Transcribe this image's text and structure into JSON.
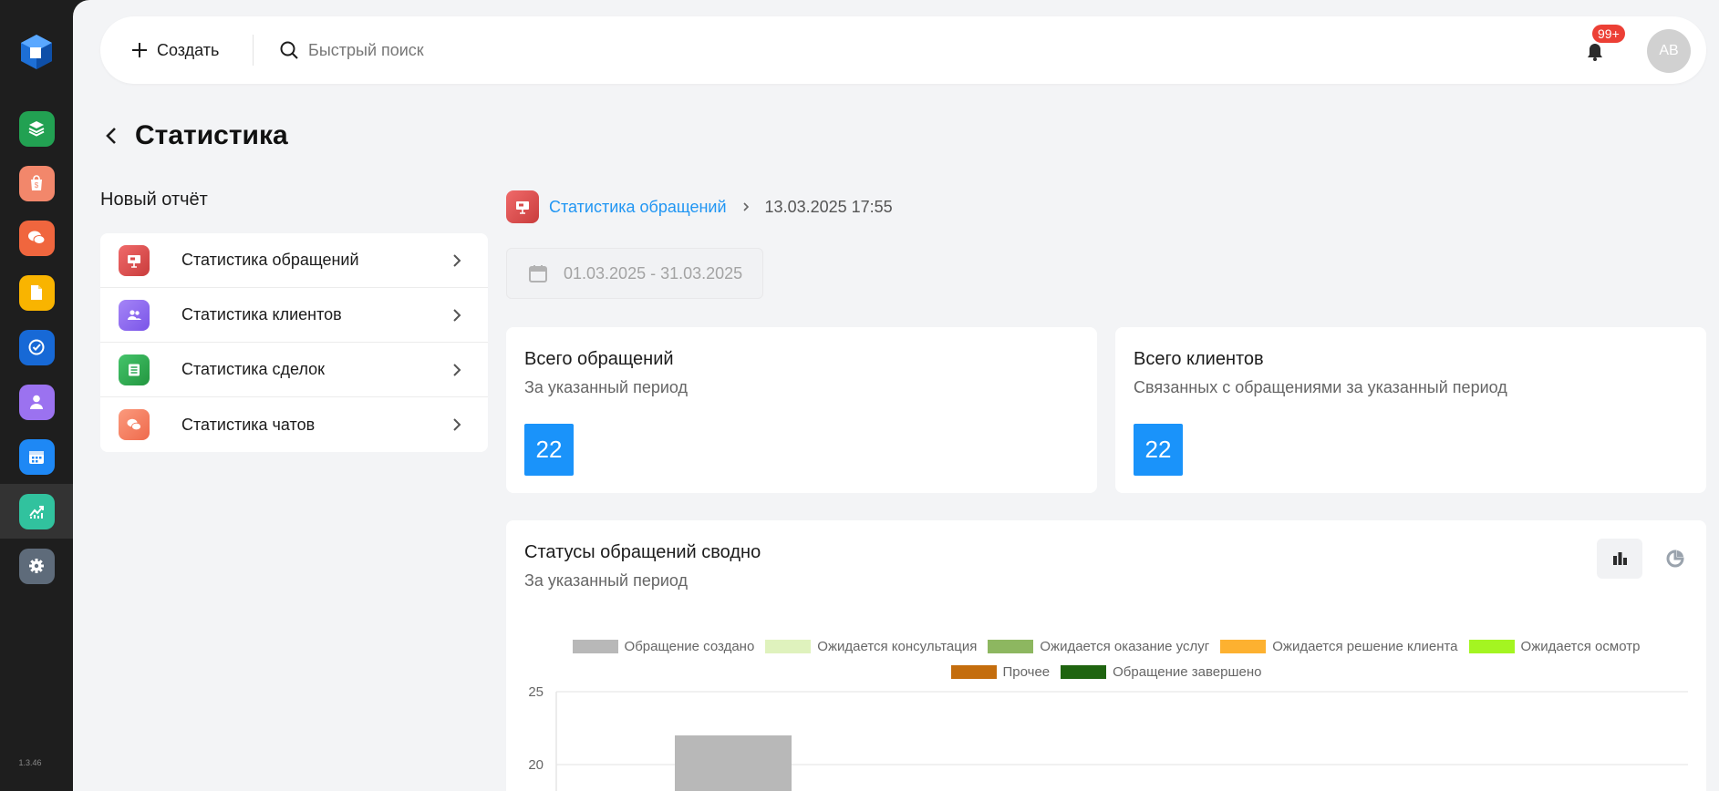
{
  "app": {
    "version": "1.3.46",
    "brand_color": "#1a93fa"
  },
  "sidebar": {
    "items": [
      {
        "name": "layers",
        "icon": "layers-icon",
        "color": "#22a152"
      },
      {
        "name": "shop",
        "icon": "shopping-bag-icon",
        "color": "#f2876b"
      },
      {
        "name": "chats",
        "icon": "chat-bubbles-icon",
        "color": "#f0663e"
      },
      {
        "name": "documents",
        "icon": "document-icon",
        "color": "#f9b400"
      },
      {
        "name": "tasks",
        "icon": "check-circle-icon",
        "color": "#1769d6"
      },
      {
        "name": "clients",
        "icon": "user-icon",
        "color": "#9b72f0"
      },
      {
        "name": "calendar",
        "icon": "calendar-icon",
        "color": "#1e88f5"
      },
      {
        "name": "statistics",
        "icon": "chart-line-icon",
        "color": "#31c29e",
        "active": true
      },
      {
        "name": "settings",
        "icon": "gear-icon",
        "color": "#5e6b7a"
      }
    ]
  },
  "topbar": {
    "create_label": "Создать",
    "search_placeholder": "Быстрый поиск",
    "notifications_badge": "99+",
    "avatar_initials": "AB"
  },
  "page": {
    "title": "Статистика"
  },
  "reports": {
    "heading": "Новый отчёт",
    "items": [
      {
        "label": "Статистика обращений",
        "icon": "presentation-icon",
        "color": "#e0504f"
      },
      {
        "label": "Статистика клиентов",
        "icon": "users-icon",
        "color": "#8d6cf2"
      },
      {
        "label": "Статистика сделок",
        "icon": "list-icon",
        "color": "#2ea857"
      },
      {
        "label": "Статистика чатов",
        "icon": "chat-bubbles-icon",
        "color": "#f47a5d"
      }
    ]
  },
  "breadcrumb": {
    "link": "Статистика обращений",
    "timestamp": "13.03.2025 17:55"
  },
  "filter": {
    "date_range": "01.03.2025 - 31.03.2025"
  },
  "kpi": [
    {
      "title": "Всего обращений",
      "subtitle": "За указанный период",
      "value": "22"
    },
    {
      "title": "Всего клиентов",
      "subtitle": "Связанных с обращениями за указанный период",
      "value": "22"
    }
  ],
  "status_chart": {
    "title": "Статусы обращений сводно",
    "subtitle": "За указанный период"
  },
  "chart_data": {
    "type": "bar",
    "title": "Статусы обращений сводно",
    "ylim": [
      0,
      25
    ],
    "yticks": [
      "25",
      "20"
    ],
    "grid": true,
    "legend_position": "top",
    "series": [
      {
        "name": "Обращение создано",
        "color": "#b8b8b8",
        "values": [
          22
        ]
      },
      {
        "name": "Ожидается консультация",
        "color": "#dff2bd",
        "values": [
          null
        ]
      },
      {
        "name": "Ожидается оказание услуг",
        "color": "#8db760",
        "values": [
          null
        ]
      },
      {
        "name": "Ожидается решение клиента",
        "color": "#fdb130",
        "values": [
          null
        ]
      },
      {
        "name": "Ожидается осмотр",
        "color": "#a4f521",
        "values": [
          null
        ]
      },
      {
        "name": "Прочее",
        "color": "#c46d0d",
        "values": [
          null
        ]
      },
      {
        "name": "Обращение завершено",
        "color": "#1f6410",
        "values": [
          null
        ]
      }
    ]
  }
}
